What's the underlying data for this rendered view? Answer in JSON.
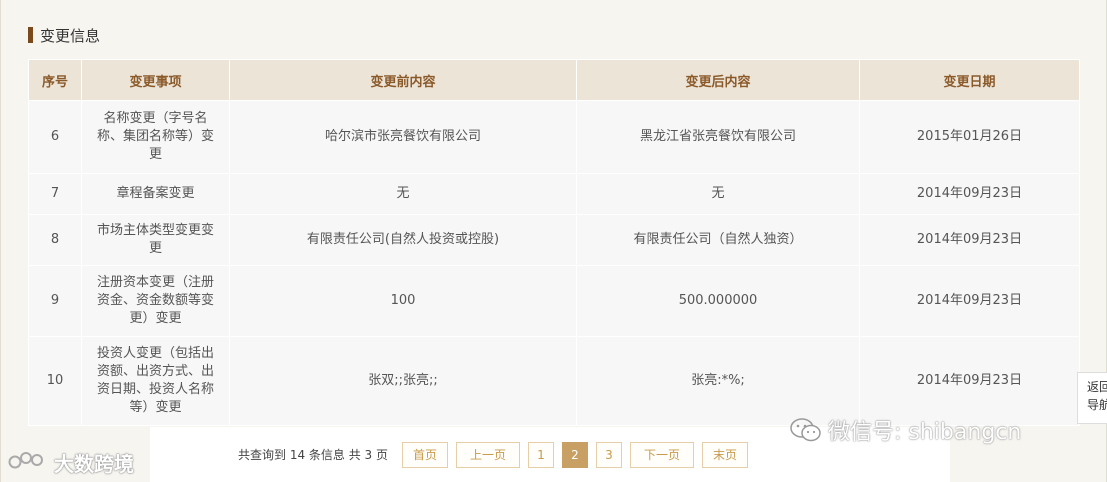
{
  "section": {
    "title": "变更信息"
  },
  "table": {
    "headers": [
      "序号",
      "变更事项",
      "变更前内容",
      "变更后内容",
      "变更日期"
    ],
    "rows": [
      {
        "no": "6",
        "item": "名称变更（字号名称、集团名称等）变更",
        "before": "哈尔滨市张亮餐饮有限公司",
        "after": "黑龙江省张亮餐饮有限公司",
        "date": "2015年01月26日"
      },
      {
        "no": "7",
        "item": "章程备案变更",
        "before": "无",
        "after": "无",
        "date": "2014年09月23日"
      },
      {
        "no": "8",
        "item": "市场主体类型变更变更",
        "before": "有限责任公司(自然人投资或控股)",
        "after": "有限责任公司（自然人独资）",
        "date": "2014年09月23日"
      },
      {
        "no": "9",
        "item": "注册资本变更（注册资金、资金数额等变更）变更",
        "before": "100",
        "after": "500.000000",
        "date": "2014年09月23日"
      },
      {
        "no": "10",
        "item": "投资人变更（包括出资额、出资方式、出资日期、投资人名称等）变更",
        "before": "张双;;张亮;;",
        "after": "张亮:*%;",
        "date": "2014年09月23日"
      }
    ]
  },
  "pagination": {
    "info": "共查询到 14 条信息 共 3 页",
    "first": "首页",
    "prev": "上一页",
    "pages": [
      "1",
      "2",
      "3"
    ],
    "current": "2",
    "next": "下一页",
    "last": "末页"
  },
  "float_tab": {
    "line1": "返回",
    "line2": "导航"
  },
  "watermarks": {
    "wechat": "微信号: shibangcn",
    "brand": "大数跨境"
  },
  "colors": {
    "header_bg": "#ece4d6",
    "header_text": "#8b5a2b",
    "accent": "#c9a063",
    "section_bar": "#7a4a1c"
  }
}
